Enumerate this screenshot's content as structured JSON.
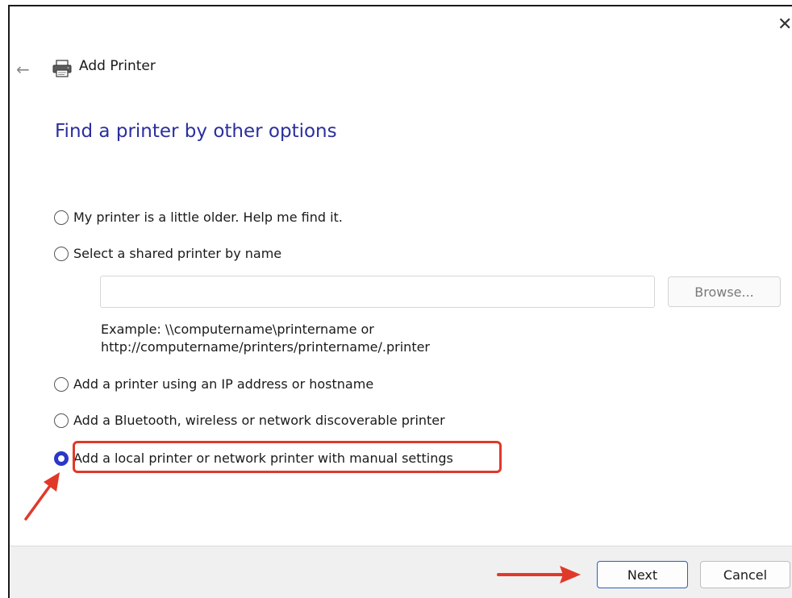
{
  "window": {
    "title": "Add Printer",
    "close_glyph": "✕",
    "back_glyph": "←"
  },
  "heading": "Find a printer by other options",
  "options": [
    {
      "label": "My printer is a little older. Help me find it.",
      "selected": false
    },
    {
      "label": "Select a shared printer by name",
      "selected": false
    },
    {
      "label": "Add a printer using an IP address or hostname",
      "selected": false
    },
    {
      "label": "Add a Bluetooth, wireless or network discoverable printer",
      "selected": false
    },
    {
      "label": "Add a local printer or network printer with manual settings",
      "selected": true
    }
  ],
  "shared_printer": {
    "input_value": "",
    "browse_label": "Browse...",
    "example_line1": "Example: \\\\computername\\printername or",
    "example_line2": "http://computername/printers/printername/.printer"
  },
  "footer": {
    "next_label": "Next",
    "cancel_label": "Cancel"
  },
  "colors": {
    "heading": "#2b2f9e",
    "radio_selected": "#2a37c7",
    "annotation": "#e0392a",
    "footer_bg": "#f0f0f0"
  }
}
